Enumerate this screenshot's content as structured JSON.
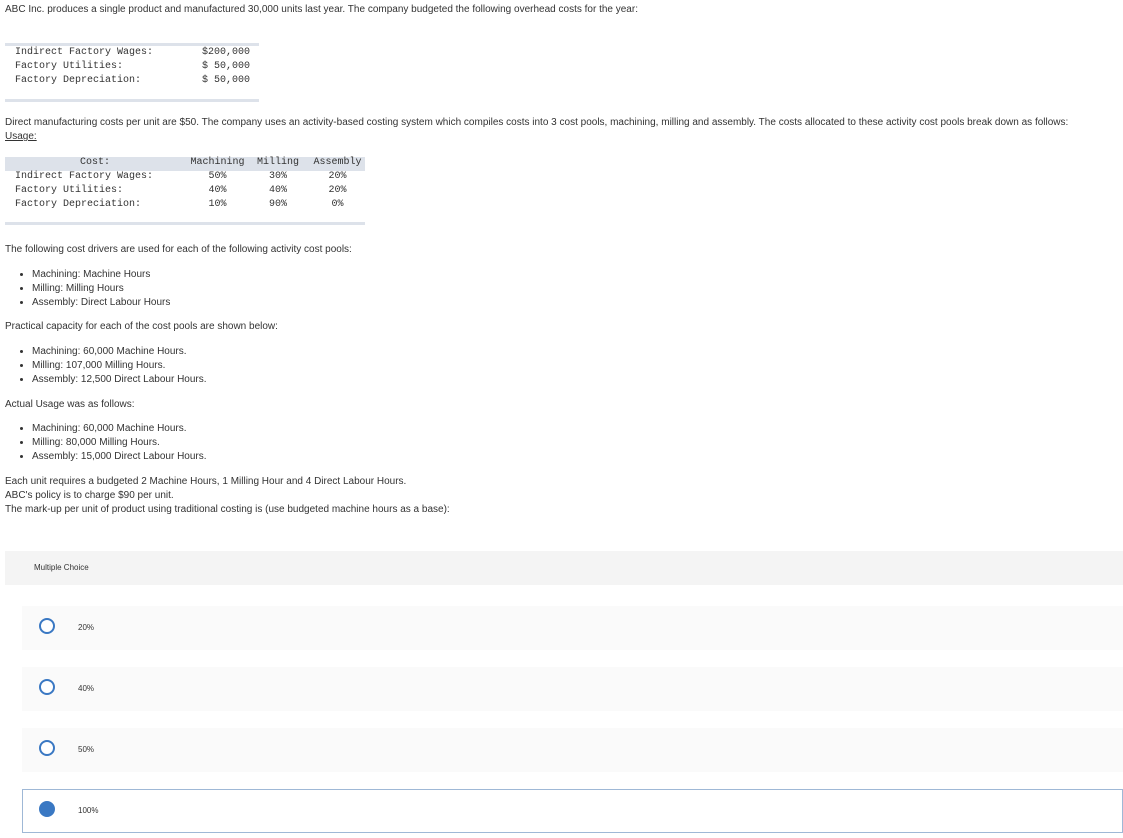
{
  "intro": "ABC Inc. produces a single product and manufactured 30,000 units last year. The company budgeted the following overhead costs for the year:",
  "overhead_costs": [
    {
      "label": "Indirect Factory Wages:",
      "value": "$200,000"
    },
    {
      "label": "Factory Utilities:",
      "value": "$ 50,000"
    },
    {
      "label": "Factory Depreciation:",
      "value": "$ 50,000"
    }
  ],
  "direct_costs_text": "Direct manufacturing costs per unit are $50. The company uses an activity-based costing system which compiles costs into 3 cost pools, machining, milling and assembly. The costs allocated to these activity cost pools break down as follows:",
  "usage_label": "Usage:",
  "usage_table": {
    "headers": [
      "Cost:",
      "Machining",
      "Milling",
      "Assembly"
    ],
    "rows": [
      {
        "label": "Indirect Factory Wages:",
        "machining": "50%",
        "milling": "30%",
        "assembly": "20%"
      },
      {
        "label": "Factory Utilities:",
        "machining": "40%",
        "milling": "40%",
        "assembly": "20%"
      },
      {
        "label": "Factory Depreciation:",
        "machining": "10%",
        "milling": "90%",
        "assembly": "0%"
      }
    ]
  },
  "drivers_intro": "The following cost drivers are used for each of the following activity cost pools:",
  "drivers": [
    "Machining: Machine Hours",
    "Milling: Milling Hours",
    "Assembly: Direct Labour Hours"
  ],
  "capacity_intro": "Practical capacity for each of the cost pools are shown below:",
  "capacity": [
    "Machining: 60,000 Machine Hours.",
    "Milling: 107,000 Milling Hours.",
    "Assembly: 12,500 Direct Labour Hours."
  ],
  "actual_intro": "Actual Usage was as follows:",
  "actual": [
    "Machining: 60,000 Machine Hours.",
    "Milling: 80,000 Milling Hours.",
    "Assembly: 15,000 Direct Labour Hours."
  ],
  "closing_lines": [
    "Each unit requires a budgeted 2 Machine Hours, 1 Milling Hour and 4 Direct Labour Hours.",
    "ABC's policy is to charge $90 per unit.",
    "The mark-up per unit of product using traditional costing is (use budgeted machine hours as a base):"
  ],
  "multiple_choice": {
    "header": "Multiple Choice",
    "options": [
      {
        "label": "20%",
        "selected": false
      },
      {
        "label": "40%",
        "selected": false
      },
      {
        "label": "50%",
        "selected": false
      },
      {
        "label": "100%",
        "selected": true
      }
    ],
    "accent_color": "#3a78c3"
  }
}
